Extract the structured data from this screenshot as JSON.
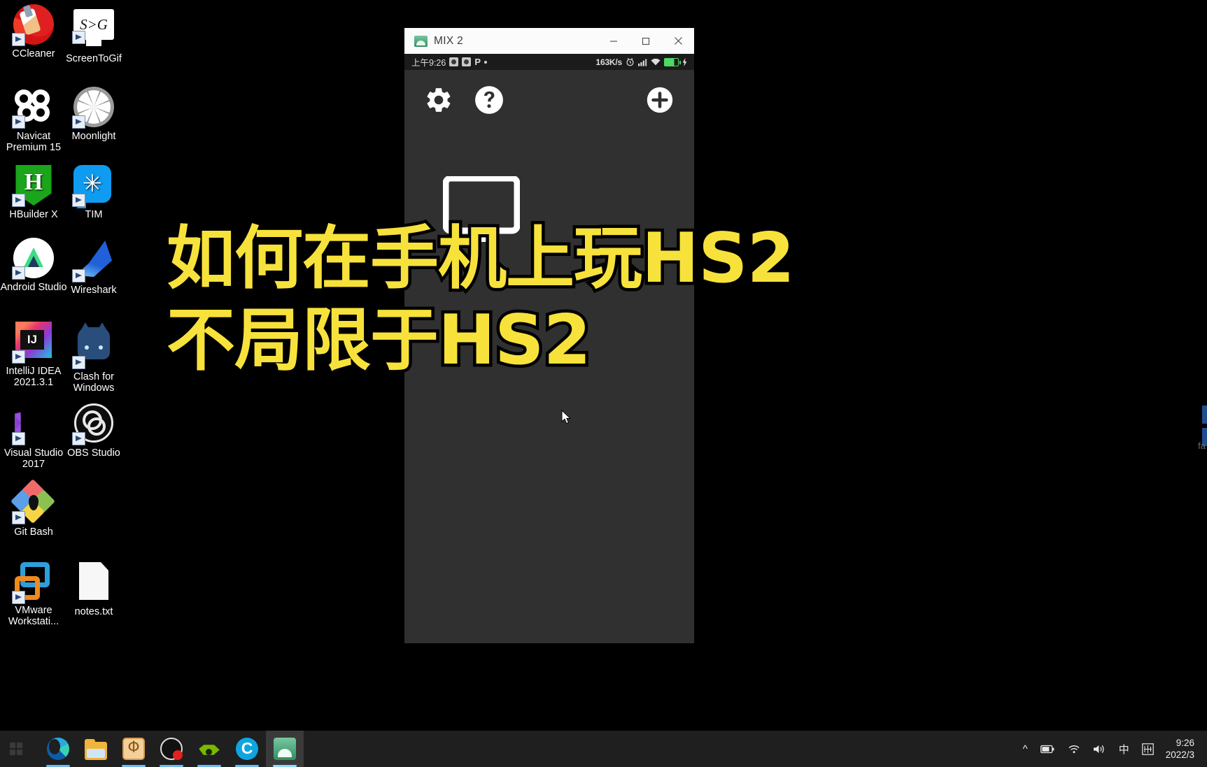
{
  "desktop": {
    "icons": [
      {
        "label": "CCleaner",
        "name": "ccleaner"
      },
      {
        "label": "ScreenToGif",
        "name": "screentogif",
        "glyph_text": "S>G"
      },
      {
        "label": "Navicat Premium 15",
        "name": "navicat-premium-15"
      },
      {
        "label": "Moonlight",
        "name": "moonlight"
      },
      {
        "label": "HBuilder X",
        "name": "hbuilder-x",
        "glyph_text": "H"
      },
      {
        "label": "TIM",
        "name": "tim",
        "glyph_text": "✳"
      },
      {
        "label": "Android Studio",
        "name": "android-studio"
      },
      {
        "label": "Wireshark",
        "name": "wireshark"
      },
      {
        "label": "IntelliJ IDEA 2021.3.1",
        "name": "intellij-idea"
      },
      {
        "label": "Clash for Windows",
        "name": "clash-for-windows"
      },
      {
        "label": "Visual Studio 2017",
        "name": "visual-studio-2017"
      },
      {
        "label": "OBS Studio",
        "name": "obs-studio"
      },
      {
        "label": "Git Bash",
        "name": "git-bash"
      },
      {
        "label": "VMware Workstati...",
        "name": "vmware-workstation"
      },
      {
        "label": "notes.txt",
        "name": "notes-txt"
      }
    ]
  },
  "window": {
    "title": "MIX 2",
    "titlebar_icon": "android-scrcpy-icon",
    "minimize_label": "—",
    "maximize_label": "▢",
    "close_label": "✕",
    "status_bar": {
      "time": "上午9:26",
      "network_speed": "163K/s",
      "p_label": "P",
      "icons": [
        "sim-card-icon",
        "sim-card-icon",
        "p-icon",
        "dot-icon",
        "alarm-icon",
        "signal-icon",
        "wifi-icon",
        "battery-icon"
      ]
    },
    "toolbar": {
      "settings_label": "⚙",
      "help_label": "?",
      "add_label": "+"
    },
    "content": {
      "device_placeholder": "monitor-icon"
    }
  },
  "subtitle": {
    "line1": "如何在手机上玩HS2",
    "line2": "不局限于HS2",
    "color": "#f7e23c",
    "outline_color": "#000000"
  },
  "edge": {
    "text": "fa"
  },
  "taskbar": {
    "start_label": "⊞",
    "items": [
      {
        "name": "taskbar-edge",
        "label": "Microsoft Edge",
        "icon": "edge-icon"
      },
      {
        "name": "taskbar-file-explorer",
        "label": "File Explorer",
        "icon": "folder-icon"
      },
      {
        "name": "taskbar-phi",
        "label": "Potplayer",
        "icon": "phi-icon",
        "glyph_text": "Φ"
      },
      {
        "name": "taskbar-obs",
        "label": "OBS Studio",
        "icon": "obs-recording-icon"
      },
      {
        "name": "taskbar-nvidia",
        "label": "NVIDIA",
        "icon": "nvidia-icon"
      },
      {
        "name": "taskbar-ccleaner",
        "label": "CCleaner",
        "icon": "ccleaner-icon",
        "glyph_text": "C"
      },
      {
        "name": "taskbar-mix2",
        "label": "MIX 2",
        "icon": "scrcpy-icon"
      }
    ],
    "tray": {
      "chevron": "^",
      "battery": "battery-icon",
      "wifi": "wifi-icon",
      "volume": "volume-icon",
      "ime": "中",
      "ime_panel": "ime-panel-icon",
      "clock_time": "9:26",
      "clock_date": "2022/3"
    }
  }
}
